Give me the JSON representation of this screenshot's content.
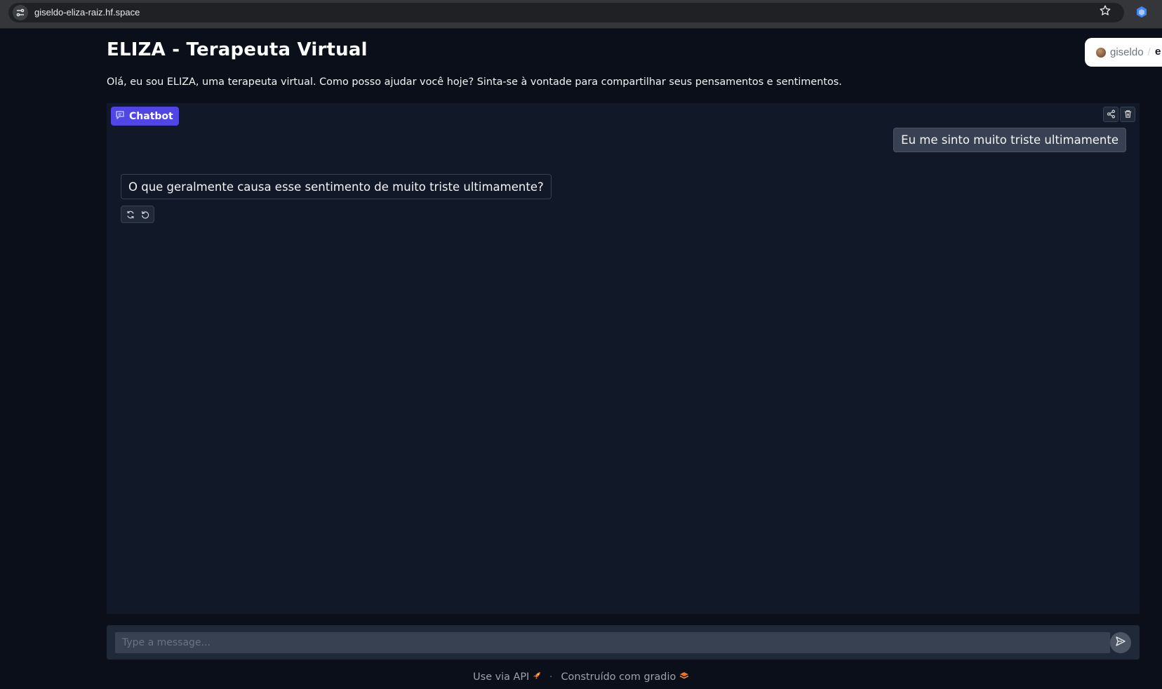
{
  "browser": {
    "url": "giseldo-eliza-raiz.hf.space",
    "icons": [
      "site-info-icon",
      "star-icon",
      "extension-icon"
    ]
  },
  "header": {
    "title": "ELIZA - Terapeuta Virtual",
    "description": "Olá, eu sou ELIZA, uma terapeuta virtual. Como posso ajudar você hoje? Sinta-se à vontade para compartilhar seus pensamentos e sentimentos."
  },
  "space_badge": {
    "user": "giseldo",
    "separator": "/",
    "space": "el"
  },
  "chatbot": {
    "label": "Chatbot",
    "messages": [
      {
        "role": "user",
        "text": "Eu me sinto muito triste ultimamente"
      },
      {
        "role": "bot",
        "text": "O que geralmente causa esse sentimento de muito triste ultimamente?"
      }
    ]
  },
  "input": {
    "placeholder": "Type a message...",
    "value": ""
  },
  "footer": {
    "api_link": "Use via API",
    "separator": "·",
    "built_with": "Construído com gradio"
  },
  "colors": {
    "background": "#0b0f19",
    "panel": "#111827",
    "accent": "#4f46e5",
    "user_bubble": "#374151"
  }
}
